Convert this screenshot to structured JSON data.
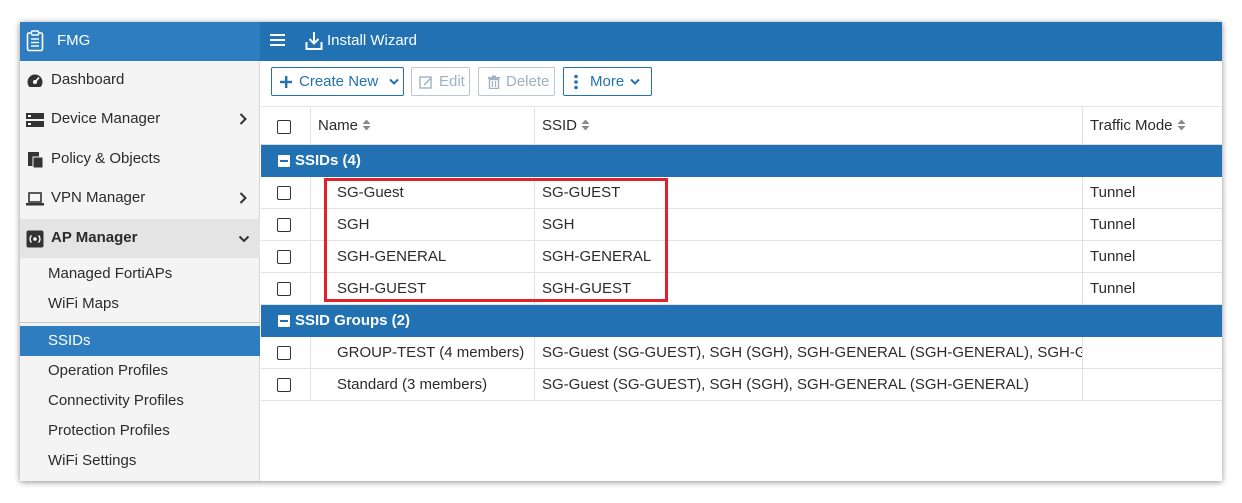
{
  "app": {
    "name": "FMG",
    "menu_icon": "hamburger-menu-icon",
    "install_wizard_label": "Install Wizard"
  },
  "sidebar": {
    "items": [
      {
        "label": "Dashboard",
        "icon": "dashboard-gauge-icon",
        "chevron": ""
      },
      {
        "label": "Device Manager",
        "icon": "device-manager-icon",
        "chevron": "right"
      },
      {
        "label": "Policy & Objects",
        "icon": "policy-objects-icon",
        "chevron": ""
      },
      {
        "label": "VPN Manager",
        "icon": "vpn-laptop-icon",
        "chevron": "right"
      },
      {
        "label": "AP Manager",
        "icon": "ap-manager-icon",
        "chevron": "down"
      }
    ],
    "ap_manager_sub": [
      "Managed FortiAPs",
      "WiFi Maps"
    ],
    "ap_manager_sub2": [
      "SSIDs",
      "Operation Profiles",
      "Connectivity Profiles",
      "Protection Profiles",
      "WiFi Settings"
    ],
    "selected": "SSIDs"
  },
  "toolbar": {
    "create_new": "Create New",
    "edit": "Edit",
    "delete": "Delete",
    "more": "More"
  },
  "table": {
    "columns": [
      "Name",
      "SSID",
      "Traffic Mode"
    ],
    "groups": [
      {
        "label": "SSIDs (4)",
        "rows": [
          {
            "name": "SG-Guest",
            "ssid": "SG-GUEST",
            "traffic_mode": "Tunnel"
          },
          {
            "name": "SGH",
            "ssid": "SGH",
            "traffic_mode": "Tunnel"
          },
          {
            "name": "SGH-GENERAL",
            "ssid": "SGH-GENERAL",
            "traffic_mode": "Tunnel"
          },
          {
            "name": "SGH-GUEST",
            "ssid": "SGH-GUEST",
            "traffic_mode": "Tunnel"
          }
        ]
      },
      {
        "label": "SSID Groups (2)",
        "rows": [
          {
            "name": "GROUP-TEST (4 members)",
            "ssid": "SG-Guest (SG-GUEST), SGH (SGH), SGH-GENERAL (SGH-GENERAL), SGH-GUEST",
            "traffic_mode": ""
          },
          {
            "name": "Standard (3 members)",
            "ssid": "SG-Guest (SG-GUEST), SGH (SGH), SGH-GENERAL (SGH-GENERAL)",
            "traffic_mode": ""
          }
        ]
      }
    ]
  },
  "colors": {
    "header_blue": "#2271b3",
    "selected_blue": "#2d7dc0",
    "highlight_red": "#e0222d"
  }
}
